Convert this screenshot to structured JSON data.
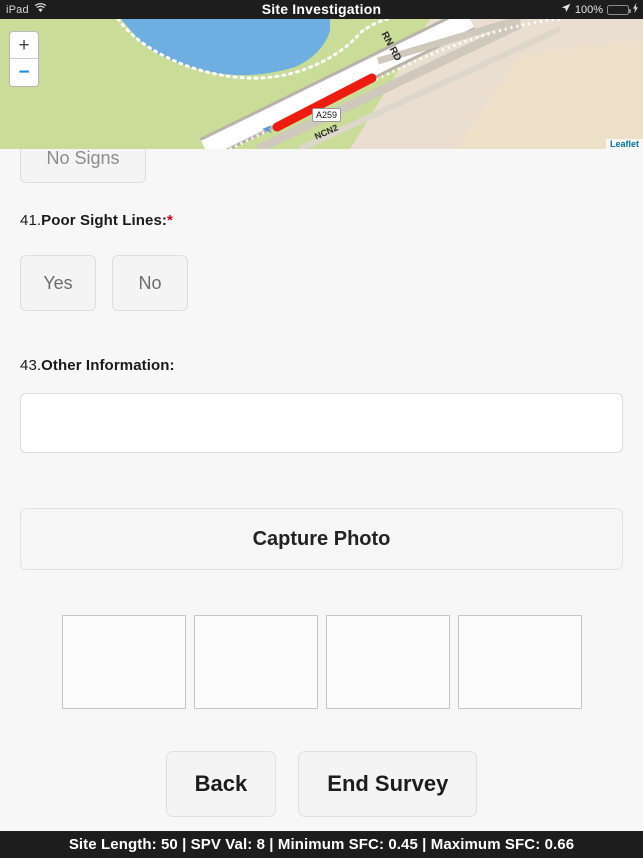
{
  "statusbar": {
    "device": "iPad",
    "wifi_icon": "wifi-icon",
    "title": "Site Investigation",
    "location_icon": "location-arrow-icon",
    "battery_percent": "100%",
    "battery_icon": "battery-full-icon",
    "charging_icon": "lightning-bolt-icon"
  },
  "map": {
    "zoom_in_label": "+",
    "zoom_out_label": "−",
    "attribution": "Leaflet",
    "labels": [
      {
        "text": "A259",
        "type": "road-shield"
      },
      {
        "text": "NCN2",
        "type": "route-label"
      },
      {
        "text": "RN RD",
        "type": "street-label"
      }
    ],
    "colors": {
      "land": "#c9dc98",
      "water": "#6eaee0",
      "built_up": "#e9ded0",
      "sand": "#ece0c8",
      "road": "#ffffff",
      "highlight_route": "#ee1b11"
    }
  },
  "form": {
    "occluded_question": {
      "option_label": "No Signs"
    },
    "questions": [
      {
        "number": "41.",
        "label": "Poor Sight Lines:",
        "required": "*",
        "options": [
          "Yes",
          "No"
        ]
      },
      {
        "number": "43.",
        "label": "Other Information:",
        "required": "",
        "value": "",
        "placeholder": ""
      }
    ],
    "capture_photo_label": "Capture Photo",
    "photo_slots": [
      "",
      "",
      "",
      ""
    ],
    "nav": {
      "back_label": "Back",
      "end_survey_label": "End Survey"
    }
  },
  "footer": {
    "summary": "Site Length: 50 | SPV Val: 8 | Minimum SFC: 0.45 | Maximum SFC: 0.66",
    "site_length": "50",
    "spv_val": "8",
    "minimum_sfc": "0.45",
    "maximum_sfc": "0.66"
  }
}
